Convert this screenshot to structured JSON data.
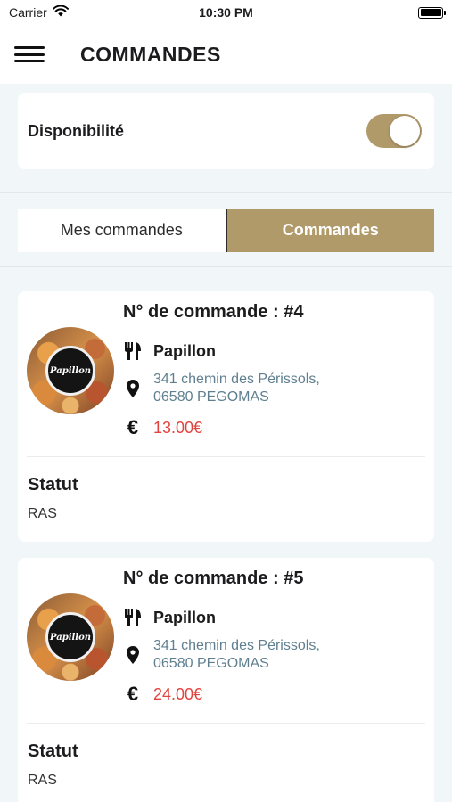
{
  "status_bar": {
    "carrier": "Carrier",
    "time": "10:30 PM"
  },
  "header": {
    "title": "COMMANDES"
  },
  "availability": {
    "label": "Disponibilité",
    "enabled": true
  },
  "tabs": [
    {
      "label": "Mes commandes",
      "active": false
    },
    {
      "label": "Commandes",
      "active": true
    }
  ],
  "orders": [
    {
      "number_label": "N° de commande : #4",
      "restaurant": "Papillon",
      "address_line1": "341 chemin des Périssols,",
      "address_line2": "06580 PEGOMAS",
      "price": "13.00€",
      "status_title": "Statut",
      "status_value": "RAS",
      "logo_text": "Papillon"
    },
    {
      "number_label": "N° de commande : #5",
      "restaurant": "Papillon",
      "address_line1": "341 chemin des Périssols,",
      "address_line2": "06580 PEGOMAS",
      "price": "24.00€",
      "status_title": "Statut",
      "status_value": "RAS",
      "logo_text": "Papillon"
    }
  ],
  "icons": {
    "restaurant": "fork-knife-icon",
    "location": "map-pin-icon",
    "currency": "euro-icon"
  },
  "colors": {
    "accent": "#b19a6a",
    "price": "#e2433d",
    "address": "#5f7f90"
  }
}
